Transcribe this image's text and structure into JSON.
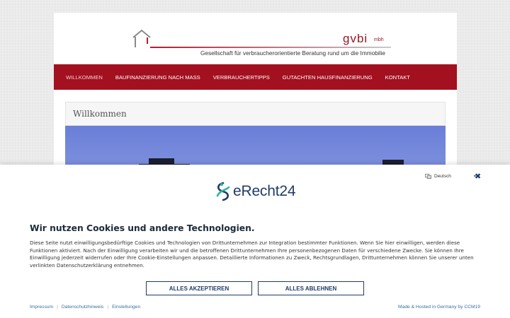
{
  "site": {
    "brand": "gvbi",
    "brand_suffix": "mbh",
    "tagline": "Gesellschaft für verbraucherorientierte Beratung rund um die Immobilie",
    "nav": [
      {
        "label": "WILLKOMMEN",
        "active": true
      },
      {
        "label": "BAUFINANZIERUNG NACH MASS",
        "active": false
      },
      {
        "label": "VERBRAUCHERTIPPS",
        "active": false
      },
      {
        "label": "GUTACHTEN HAUSFINANZIERUNG",
        "active": false
      },
      {
        "label": "KONTAKT",
        "active": false
      }
    ],
    "page_title": "Willkommen"
  },
  "cookie_banner": {
    "language": "Deutsch",
    "logo_text": "eRecht24",
    "heading": "Wir nutzen Cookies und andere Technologien.",
    "body": "Diese Seite nutzt einwilligungsbedürftige Cookies und Technologien von Drittunternehmen zur Integration bestimmter Funktionen. Wenn Sie hier einwilligen, werden diese Funktionen aktiviert. Nach der Einwilligung verarbeiten wir und die betroffenen Drittunternehmen Ihre personenbezogenen Daten für verschiedene Zwecke. Sie können Ihre Einwilligung jederzeit widerrufen oder Ihre Cookie-Einstellungen anpassen. Detaillierte Informationen zu Zweck, Rechtsgrundlagen, Drittunternehmen können Sie unserer unten verlinkten Datenschutzerklärung entnehmen.",
    "accept_label": "ALLES AKZEPTIEREN",
    "reject_label": "ALLES ABLEHNEN",
    "footer_links": [
      "Impressum",
      "Datenschutzhinweis",
      "Einstellungen"
    ],
    "made_by": "Made & Hosted in Germany by CCM19"
  },
  "colors": {
    "nav_bg": "#a3101f",
    "brand_red": "#9a1622",
    "banner_navy": "#1f3c66",
    "link_blue": "#3a6ea5"
  },
  "icons": [
    "house-logo-icon",
    "globe-icon",
    "close-icon",
    "erecht24-logo-icon"
  ]
}
